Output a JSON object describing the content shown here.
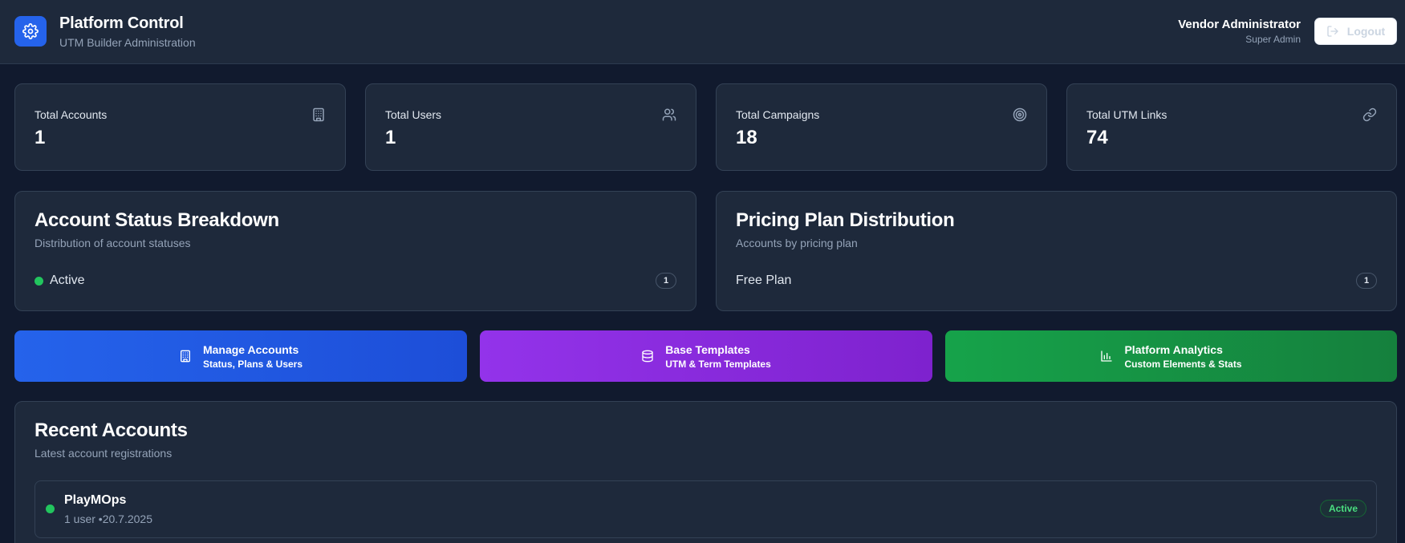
{
  "header": {
    "title": "Platform Control",
    "subtitle": "UTM Builder Administration",
    "user_name": "Vendor Administrator",
    "user_role": "Super Admin",
    "logout_label": "Logout"
  },
  "stats": [
    {
      "label": "Total Accounts",
      "value": "1",
      "icon": "building-icon"
    },
    {
      "label": "Total Users",
      "value": "1",
      "icon": "users-icon"
    },
    {
      "label": "Total Campaigns",
      "value": "18",
      "icon": "target-icon"
    },
    {
      "label": "Total UTM Links",
      "value": "74",
      "icon": "link-icon"
    }
  ],
  "status_panel": {
    "title": "Account Status Breakdown",
    "subtitle": "Distribution of account statuses",
    "rows": [
      {
        "label": "Active",
        "count": "1",
        "color": "#22c55e"
      }
    ]
  },
  "pricing_panel": {
    "title": "Pricing Plan Distribution",
    "subtitle": "Accounts by pricing plan",
    "rows": [
      {
        "label": "Free Plan",
        "count": "1"
      }
    ]
  },
  "actions": [
    {
      "title": "Manage Accounts",
      "subtitle": "Status, Plans & Users",
      "icon": "building-icon",
      "color": "#2563eb"
    },
    {
      "title": "Base Templates",
      "subtitle": "UTM & Term Templates",
      "icon": "database-icon",
      "color": "#9333ea"
    },
    {
      "title": "Platform Analytics",
      "subtitle": "Custom Elements & Stats",
      "icon": "bar-chart-icon",
      "color": "#16a34a"
    }
  ],
  "recent": {
    "title": "Recent Accounts",
    "subtitle": "Latest account registrations",
    "accounts": [
      {
        "name": "PlayMOps",
        "meta": "1 user •20.7.2025",
        "status": "Active"
      }
    ]
  },
  "colors": {
    "background": "#111a2e",
    "card": "#1e293b",
    "accent": "#2563eb",
    "active": "#22c55e"
  }
}
